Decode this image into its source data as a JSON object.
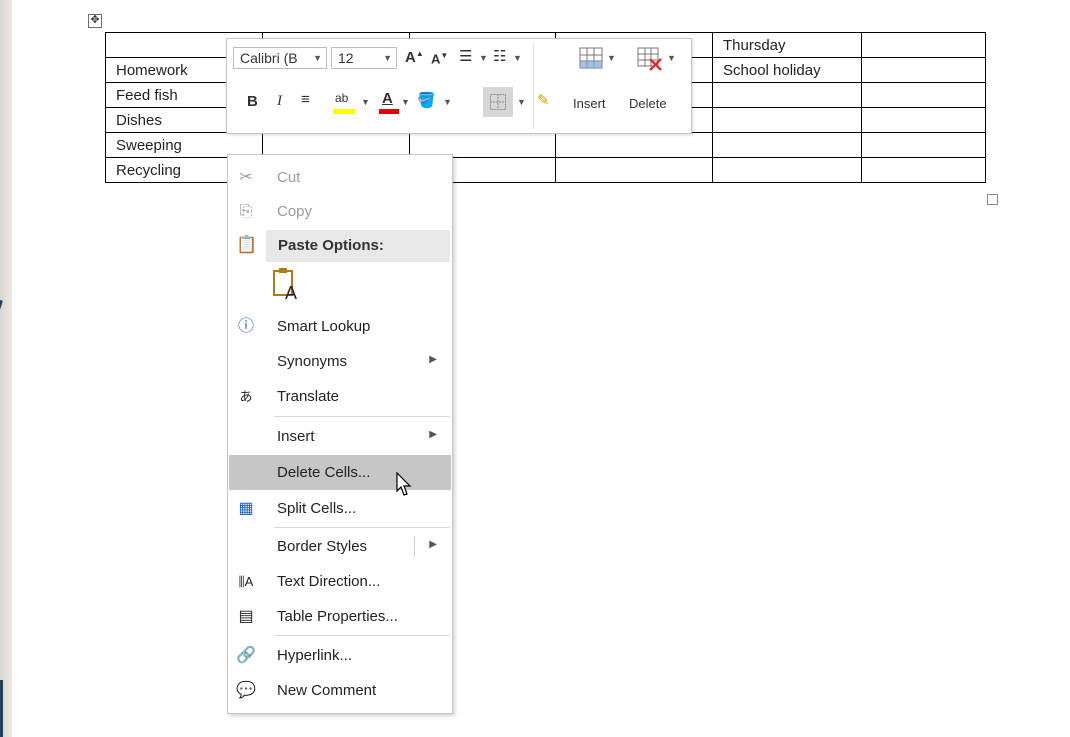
{
  "table": {
    "rows": [
      [
        "",
        "",
        "",
        "",
        "Thursday",
        ""
      ],
      [
        "Homework",
        "",
        "",
        "",
        "School holiday",
        ""
      ],
      [
        "Feed fish",
        "",
        "",
        "",
        "",
        ""
      ],
      [
        "Dishes",
        "",
        "",
        "",
        "",
        ""
      ],
      [
        "Sweeping",
        "",
        "",
        "",
        "",
        ""
      ],
      [
        "Recycling",
        "",
        "",
        "",
        "",
        ""
      ]
    ]
  },
  "mini_toolbar": {
    "font_name": "Calibri (B",
    "font_size": "12",
    "insert_label": "Insert",
    "delete_label": "Delete",
    "highlight_color": "#ffff00",
    "font_color": "#e00000"
  },
  "context_menu": {
    "cut": "Cut",
    "copy": "Copy",
    "paste_options": "Paste Options:",
    "smart_lookup": "Smart Lookup",
    "synonyms": "Synonyms",
    "translate": "Translate",
    "insert": "Insert",
    "delete_cells": "Delete Cells...",
    "split_cells": "Split Cells...",
    "border_styles": "Border Styles",
    "text_direction": "Text Direction...",
    "table_properties": "Table Properties...",
    "hyperlink": "Hyperlink...",
    "new_comment": "New Comment",
    "hover_color": "#c6c6c6"
  },
  "icons": {
    "move_handle": "table-move-icon",
    "cut": "scissors-icon",
    "copy": "copy-icon",
    "paste": "clipboard-icon",
    "smart_lookup": "lookup-icon",
    "translate": "translate-icon",
    "split_cells": "grid-icon",
    "text_direction": "text-direction-icon",
    "table_properties": "table-properties-icon",
    "hyperlink": "link-icon",
    "new_comment": "comment-icon"
  }
}
